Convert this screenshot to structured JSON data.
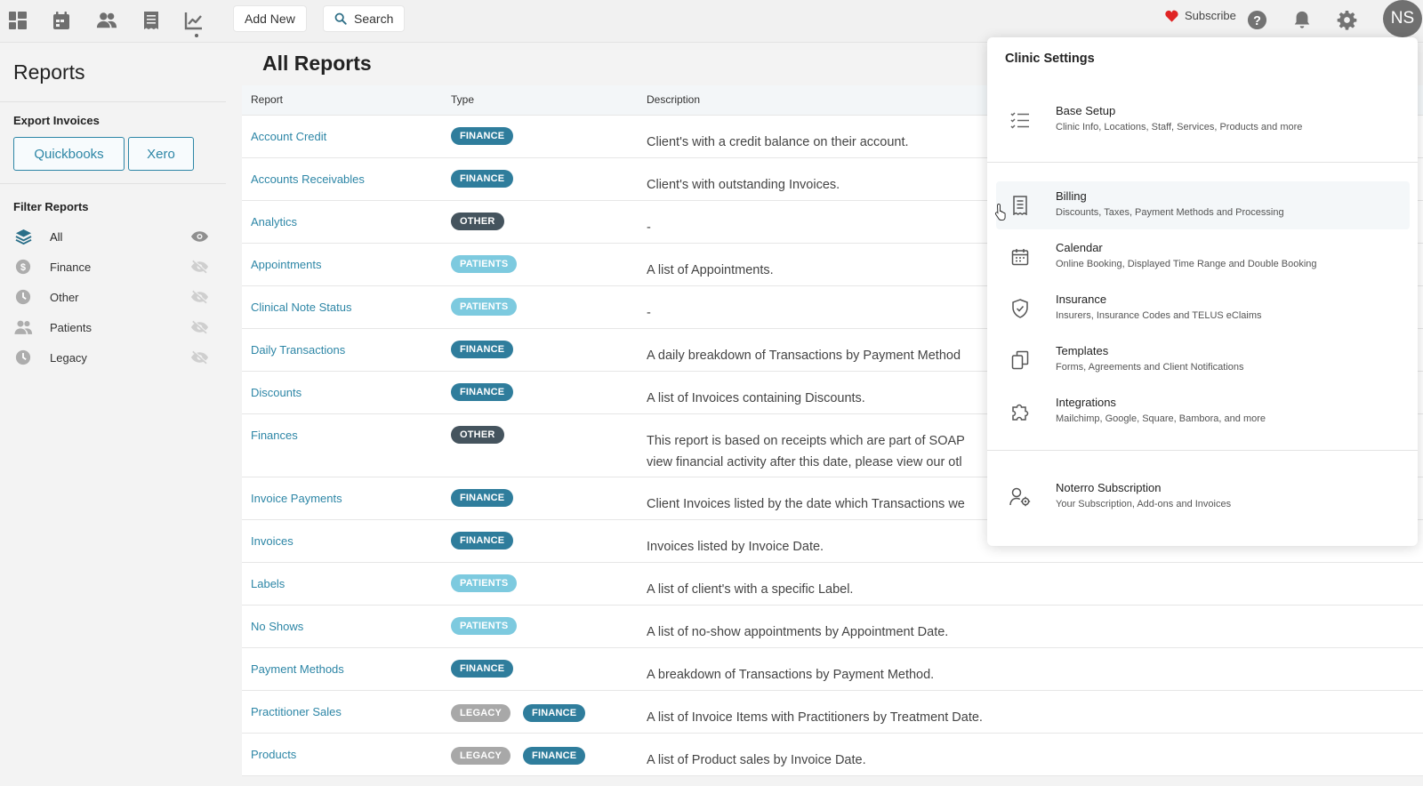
{
  "topbar": {
    "add_new_label": "Add New",
    "search_label": "Search",
    "subscribe_label": "Subscribe",
    "avatar_initials": "NS",
    "accent_color": "#2d86a6"
  },
  "sidebar": {
    "title": "Reports",
    "export_heading": "Export Invoices",
    "export_buttons": [
      "Quickbooks",
      "Xero"
    ],
    "filter_heading": "Filter Reports",
    "filters": [
      {
        "label": "All",
        "icon": "stack-icon",
        "visible": true
      },
      {
        "label": "Finance",
        "icon": "dollar-icon",
        "visible": false
      },
      {
        "label": "Other",
        "icon": "clock-icon",
        "visible": false
      },
      {
        "label": "Patients",
        "icon": "people-icon",
        "visible": false
      },
      {
        "label": "Legacy",
        "icon": "clock-icon",
        "visible": false
      }
    ]
  },
  "main": {
    "title": "All Reports",
    "columns": {
      "report": "Report",
      "type": "Type",
      "description": "Description"
    },
    "rows": [
      {
        "report": "Account Credit",
        "types": [
          "FINANCE"
        ],
        "description": "Client's with a credit balance on their account."
      },
      {
        "report": "Accounts Receivables",
        "types": [
          "FINANCE"
        ],
        "description": "Client's with outstanding Invoices."
      },
      {
        "report": "Analytics",
        "types": [
          "OTHER"
        ],
        "description": "-"
      },
      {
        "report": "Appointments",
        "types": [
          "PATIENTS"
        ],
        "description": "A list of Appointments."
      },
      {
        "report": "Clinical Note Status",
        "types": [
          "PATIENTS"
        ],
        "description": "-"
      },
      {
        "report": "Daily Transactions",
        "types": [
          "FINANCE"
        ],
        "description": "A daily breakdown of Transactions by Payment Method"
      },
      {
        "report": "Discounts",
        "types": [
          "FINANCE"
        ],
        "description": "A list of Invoices containing Discounts."
      },
      {
        "report": "Finances",
        "types": [
          "OTHER"
        ],
        "description": "This report is based on receipts which are part of SOAP",
        "description2": "view financial activity after this date, please view our otl"
      },
      {
        "report": "Invoice Payments",
        "types": [
          "FINANCE"
        ],
        "description": "Client Invoices listed by the date which Transactions we"
      },
      {
        "report": "Invoices",
        "types": [
          "FINANCE"
        ],
        "description": "Invoices listed by Invoice Date."
      },
      {
        "report": "Labels",
        "types": [
          "PATIENTS"
        ],
        "description": "A list of client's with a specific Label."
      },
      {
        "report": "No Shows",
        "types": [
          "PATIENTS"
        ],
        "description": "A list of no-show appointments by Appointment Date."
      },
      {
        "report": "Payment Methods",
        "types": [
          "FINANCE"
        ],
        "description": "A breakdown of Transactions by Payment Method."
      },
      {
        "report": "Practitioner Sales",
        "types": [
          "LEGACY",
          "FINANCE"
        ],
        "description": "A list of Invoice Items with Practitioners by Treatment Date."
      },
      {
        "report": "Products",
        "types": [
          "LEGACY",
          "FINANCE"
        ],
        "description": "A list of Product sales by Invoice Date."
      }
    ],
    "tag_colors": {
      "FINANCE": "#2f7d9c",
      "OTHER": "#45545e",
      "PATIENTS": "#7dcadf",
      "LEGACY": "#a8a8a8"
    }
  },
  "settings_menu": {
    "title": "Clinic Settings",
    "items": [
      {
        "label": "Base Setup",
        "sub": "Clinic Info, Locations, Staff, Services, Products and more",
        "icon": "list-icon"
      },
      {
        "label": "Billing",
        "sub": "Discounts, Taxes, Payment Methods and Processing",
        "icon": "receipt-icon",
        "active": true
      },
      {
        "label": "Calendar",
        "sub": "Online Booking, Displayed Time Range and Double Booking",
        "icon": "calendar-icon"
      },
      {
        "label": "Insurance",
        "sub": "Insurers, Insurance Codes and TELUS eClaims",
        "icon": "shield-icon"
      },
      {
        "label": "Templates",
        "sub": "Forms, Agreements and Client Notifications",
        "icon": "copy-icon"
      },
      {
        "label": "Integrations",
        "sub": "Mailchimp, Google, Square, Bambora, and more",
        "icon": "puzzle-icon"
      },
      {
        "label": "Noterro Subscription",
        "sub": "Your Subscription, Add-ons and Invoices",
        "icon": "user-gear-icon"
      }
    ]
  }
}
